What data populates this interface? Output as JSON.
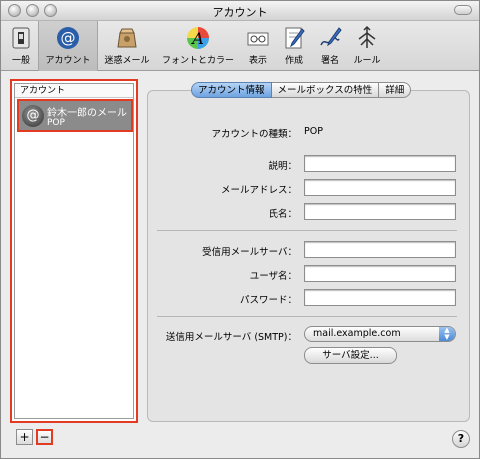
{
  "window": {
    "title": "アカウント"
  },
  "toolbar": {
    "items": [
      {
        "label": "一般",
        "icon": "switch-icon"
      },
      {
        "label": "アカウント",
        "icon": "at-sign-icon"
      },
      {
        "label": "迷惑メール",
        "icon": "junk-mail-icon"
      },
      {
        "label": "フォントとカラー",
        "icon": "fonts-colors-icon"
      },
      {
        "label": "表示",
        "icon": "viewing-icon"
      },
      {
        "label": "作成",
        "icon": "composing-icon"
      },
      {
        "label": "署名",
        "icon": "signature-icon"
      },
      {
        "label": "ルール",
        "icon": "rules-icon"
      }
    ],
    "active_index": 1
  },
  "accounts_list": {
    "header": "アカウント",
    "items": [
      {
        "name": "鈴木一郎のメール",
        "type": "POP",
        "icon": "at-sign-icon",
        "selected": true
      }
    ],
    "add_label": "+",
    "remove_label": "−"
  },
  "tabs": [
    {
      "label": "アカウント情報",
      "active": true
    },
    {
      "label": "メールボックスの特性",
      "active": false
    },
    {
      "label": "詳細",
      "active": false
    }
  ],
  "form": {
    "account_type_label": "アカウントの種類：",
    "account_type_value": "POP",
    "description_label": "説明：",
    "description_value": "",
    "email_label": "メールアドレス：",
    "email_value": "",
    "fullname_label": "氏名：",
    "fullname_value": "",
    "incoming_server_label": "受信用メールサーバ：",
    "incoming_server_value": "",
    "username_label": "ユーザ名：",
    "username_value": "",
    "password_label": "パスワード：",
    "password_value": "",
    "smtp_label": "送信用メールサーバ (SMTP)：",
    "smtp_value": "mail.example.com",
    "server_settings_button": "サーバ設定..."
  },
  "help_label": "?",
  "colors": {
    "highlight": "#e23b22",
    "selected_row": "#8b8b8b",
    "tab_active": "#6ea2e0"
  }
}
